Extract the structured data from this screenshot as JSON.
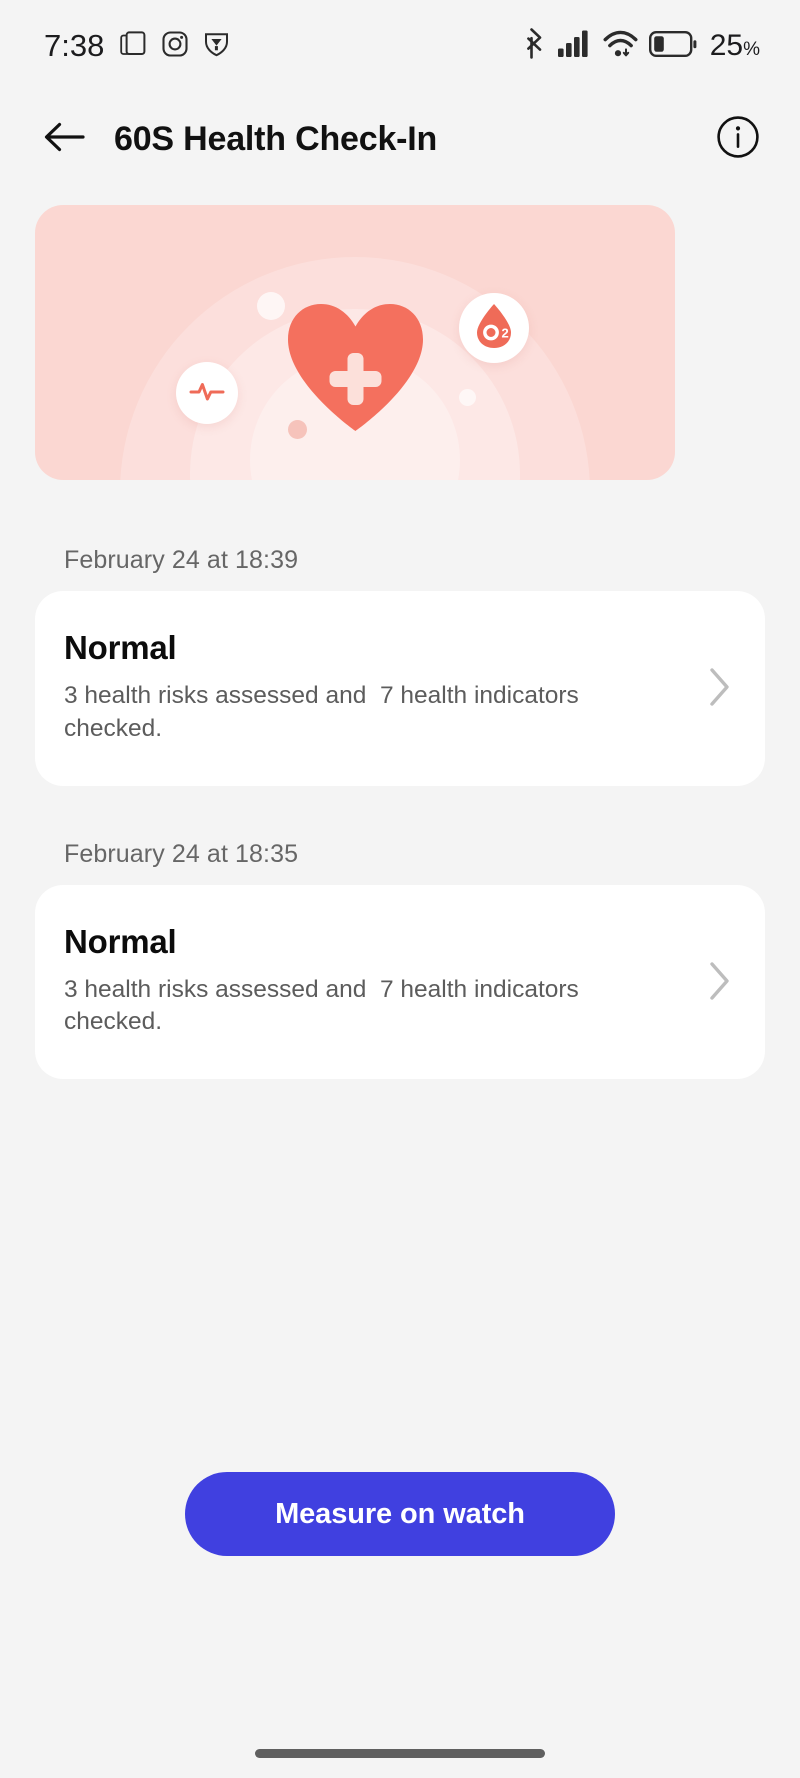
{
  "status_bar": {
    "time": "7:38",
    "left_icons": [
      "multi-window-icon",
      "instagram-icon",
      "shield-alert-icon"
    ],
    "right_icons": [
      "bluetooth-icon",
      "cellular-signal-icon",
      "wifi-icon",
      "battery-icon"
    ],
    "battery_percent": "25",
    "battery_percent_symbol": "%",
    "battery_level_fraction": 0.25,
    "signal_bars_filled": 4,
    "signal_bars_total": 4
  },
  "header": {
    "back_icon": "arrow-left-icon",
    "title": "60S Health Check-In",
    "info_icon": "info-circle-icon"
  },
  "hero": {
    "alt": "health check-in illustration",
    "background_color": "#fbd7d2",
    "heart_color": "#f4705e",
    "accent_color": "#ef6b58",
    "badges": [
      {
        "name": "ecg-badge",
        "icon": "heart-rate-pulse-icon"
      },
      {
        "name": "oxygen-badge",
        "icon": "blood-oxygen-drop-icon",
        "label": "O₂"
      }
    ]
  },
  "results": [
    {
      "date": "February 24 at 18:39",
      "status": "Normal",
      "description": "3 health risks assessed and  7 health indicators checked.",
      "chevron_icon": "chevron-right-icon"
    },
    {
      "date": "February 24 at 18:35",
      "status": "Normal",
      "description": "3 health risks assessed and  7 health indicators checked.",
      "chevron_icon": "chevron-right-icon"
    }
  ],
  "cta": {
    "label": "Measure on watch",
    "color": "#4040e0"
  },
  "nav": {
    "home_indicator": "home-indicator"
  }
}
